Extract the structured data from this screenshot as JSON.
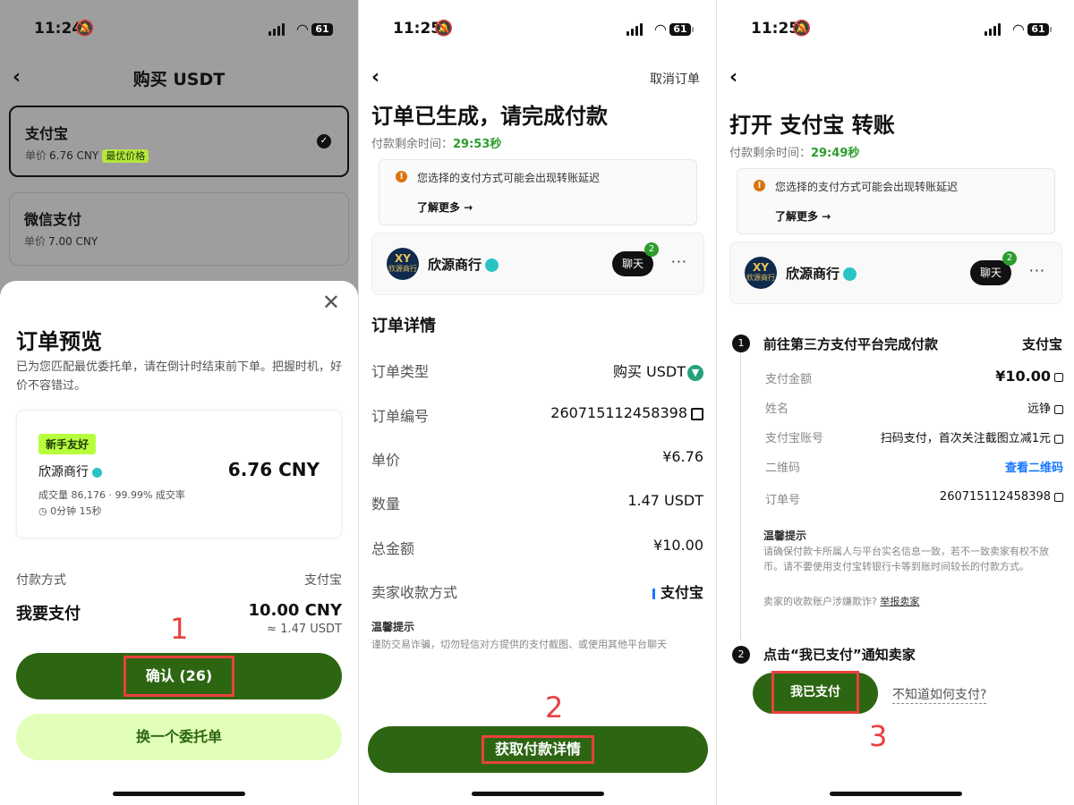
{
  "panel1": {
    "status": {
      "time": "11:24",
      "battery": "61"
    },
    "title": "购买 USDT",
    "methods": [
      {
        "name": "支付宝",
        "unit_label": "单价",
        "price": "6.76 CNY",
        "badge": "最优价格"
      },
      {
        "name": "微信支付",
        "unit_label": "单价",
        "price": "7.00 CNY"
      }
    ],
    "sheet": {
      "title": "订单预览",
      "desc": "已为您匹配最优委托单，请在倒计时结束前下单。把握时机，好价不容错过。",
      "badge": "新手友好",
      "merchant": "欣源商行",
      "price": "6.76 CNY",
      "stats": "成交量 86,176 · 99.99% 成交率",
      "time": "0分钟 15秒",
      "pay_method_label": "付款方式",
      "pay_method_value": "支付宝",
      "pay_label": "我要支付",
      "pay_amount": "10.00 CNY",
      "pay_approx": "≈ 1.47 USDT",
      "confirm_label": "确认 (26)",
      "change_label": "换一个委托单",
      "step": "1"
    }
  },
  "panel2": {
    "status": {
      "time": "11:25",
      "battery": "61"
    },
    "cancel_label": "取消订单",
    "title": "订单已生成，请完成付款",
    "timer_label": "付款剩余时间：",
    "timer_value": "29:53秒",
    "warning": "您选择的支付方式可能会出现转账延迟",
    "learn_more": "了解更多 →",
    "merchant": "欣源商行",
    "logo_text": "欣源商行",
    "chat_label": "聊天",
    "chat_badge": "2",
    "details_title": "订单详情",
    "rows": [
      {
        "label": "订单类型",
        "value": "购买 USDT"
      },
      {
        "label": "订单编号",
        "value": "260715112458398"
      },
      {
        "label": "单价",
        "value": "¥6.76"
      },
      {
        "label": "数量",
        "value": "1.47 USDT"
      },
      {
        "label": "总金额",
        "value": "¥10.00"
      },
      {
        "label": "卖家收款方式",
        "value": "支付宝"
      }
    ],
    "tips_title": "温馨提示",
    "tips_text": "谨防交易诈骗，切勿轻信对方提供的支付截图、或使用其他平台聊天",
    "button_label": "获取付款详情",
    "step": "2"
  },
  "panel3": {
    "status": {
      "time": "11:25",
      "battery": "61"
    },
    "title": "打开 支付宝 转账",
    "timer_label": "付款剩余时间：",
    "timer_value": "29:49秒",
    "warning": "您选择的支付方式可能会出现转账延迟",
    "learn_more": "了解更多 →",
    "merchant": "欣源商行",
    "chat_label": "聊天",
    "chat_badge": "2",
    "step1_title": "前往第三方支付平台完成付款",
    "step1_platform": "支付宝",
    "rows": [
      {
        "label": "支付金额",
        "value": "¥10.00"
      },
      {
        "label": "姓名",
        "value": "远铮"
      },
      {
        "label": "支付宝账号",
        "value": "扫码支付，首次关注截图立减1元"
      },
      {
        "label": "二维码",
        "value": "查看二维码"
      },
      {
        "label": "订单号",
        "value": "260715112458398"
      }
    ],
    "tips_title": "温馨提示",
    "tips_text": "请确保付款卡所属人与平台实名信息一致，若不一致卖家有权不放币。请不要使用支付宝转银行卡等到账时间较长的付款方式。",
    "tips_fraud": "卖家的收款账户涉嫌欺诈?",
    "report_label": "举报卖家",
    "step2_title": "点击“我已支付”通知卖家",
    "paid_label": "我已支付",
    "help_label": "不知道如何支付?",
    "step": "3"
  }
}
